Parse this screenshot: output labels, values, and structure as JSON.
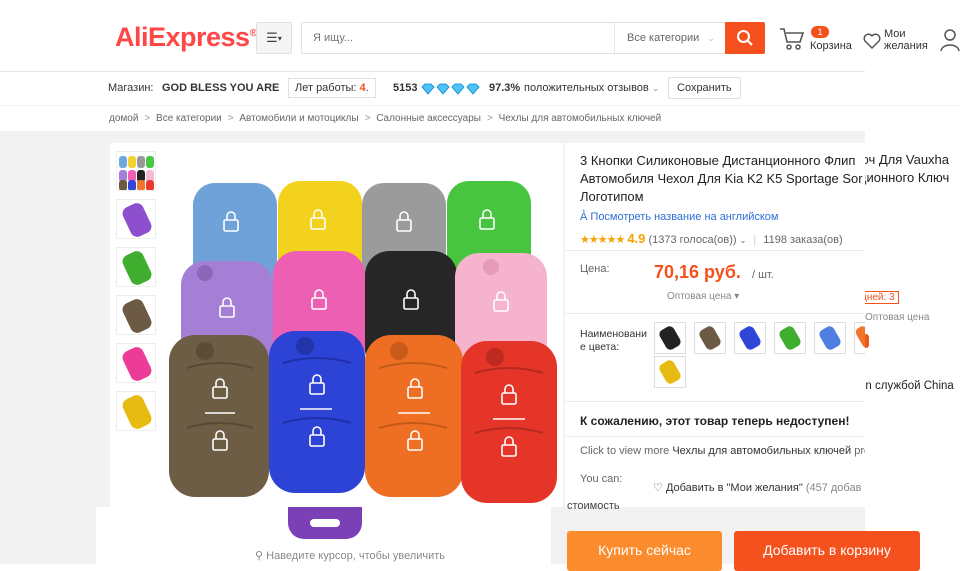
{
  "header": {
    "logo": "AliExpress",
    "logo_tm": "®",
    "search_placeholder": "Я ищу...",
    "search_category": "Все категории",
    "cart_count": "1",
    "cart_label": "Корзина",
    "wishlist_label": "Мои желания"
  },
  "store": {
    "label": "Магазин:",
    "name": "GOD BLESS YOU ARE",
    "years_label": "Лет работы:",
    "years_value": "4",
    "score": "5153",
    "positive_pct": "97.3%",
    "positive_label": "положительных отзывов",
    "save_label": "Сохранить"
  },
  "breadcrumb": [
    "домой",
    "Все категории",
    "Автомобили и мотоциклы",
    "Салонные аксессуары",
    "Чехлы для автомобильных ключей"
  ],
  "product": {
    "title": "3 Кнопки Силиконовые Дистанционного Флип Автомобиля Чехол Для Kia K2 K5 Sportage Sor Логотипом",
    "view_english": "Посмотреть название на английском",
    "rating": "4.9",
    "votes": "(1373 голоса(ов))",
    "orders": "1198 заказа(ов)",
    "price_label": "Цена:",
    "price": "70,16 руб.",
    "price_unit": "/ шт.",
    "wholesale": "Оптовая цена",
    "color_label": "Наименовани е цвета:",
    "unavailable": "К сожалению, этот товар теперь недоступен!",
    "click_view_prefix": "Click to view more",
    "click_view_link": "Чехлы для автомобильных ключей",
    "click_view_suffix": "pro",
    "you_can": "You can:",
    "wishlist_add": "Добавить в \"Мои желания\"",
    "wishlist_count": "(457 добав",
    "zoom_hint": "Наведите курсор, чтобы увеличить"
  },
  "background_layer": {
    "title_frag1": "юч Для Vauxha",
    "title_frag2": "ционного Ключ",
    "days_badge": "дней: 3",
    "wholesale": "Оптовая цена",
    "china_text": "on службой China",
    "gap_text": "стоимость",
    "buy_now": "Купить сейчас",
    "add_to_cart": "Добавить в корзину"
  },
  "colors": {
    "accent": "#f4511e",
    "orange": "#fb8c2d",
    "link": "#2e6fd6",
    "star": "#f4a300"
  },
  "swatches": [
    "black",
    "brown",
    "blue",
    "green",
    "light-blue",
    "orange",
    "yellow"
  ]
}
